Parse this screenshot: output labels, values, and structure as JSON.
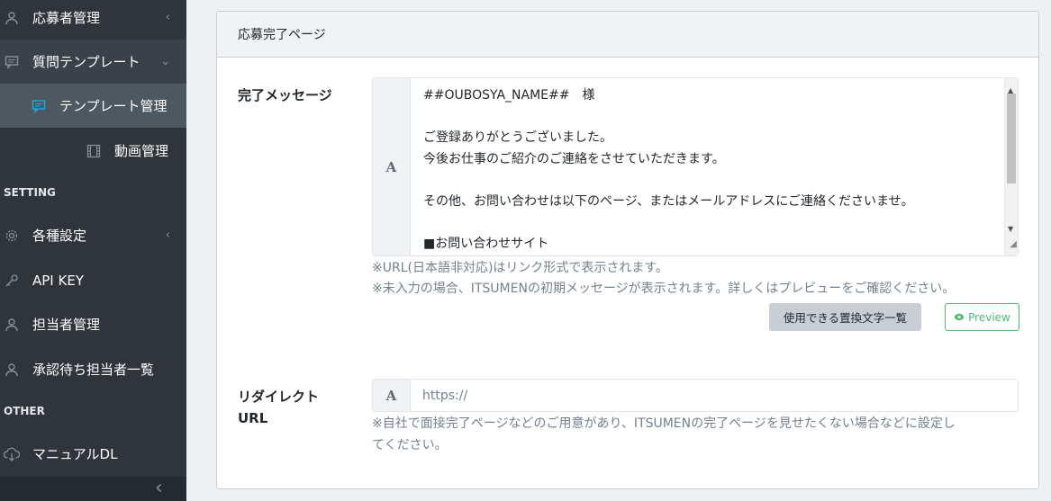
{
  "sidebar": {
    "items": [
      {
        "label": "応募者管理",
        "icon": "user-icon",
        "chevron": "‹"
      },
      {
        "label": "質問テンプレート",
        "icon": "comment-icon",
        "chevron": "⌄"
      },
      {
        "label": "テンプレート管理",
        "icon": "comment-icon"
      },
      {
        "label": "動画管理",
        "icon": "film-icon"
      },
      {
        "label": "各種設定",
        "icon": "gear-icon",
        "chevron": "‹"
      },
      {
        "label": "API KEY",
        "icon": "key-icon"
      },
      {
        "label": "担当者管理",
        "icon": "user-icon"
      },
      {
        "label": "承認待ち担当者一覧",
        "icon": "user-icon"
      },
      {
        "label": "マニュアルDL",
        "icon": "cloud-download-icon"
      }
    ],
    "section_setting": "SETTING",
    "section_other": "OTHER",
    "toggle": "‹"
  },
  "card": {
    "title": "応募完了ページ",
    "complete_message": {
      "label": "完了メッセージ",
      "addon": "A",
      "lines": [
        "##OUBOSYA_NAME##　様",
        "",
        "ご登録ありがとうございました。",
        "今後お仕事のご紹介のご連絡をさせていただきます。",
        "",
        "その他、お問い合わせは以下のページ、またはメールアドレスにご連絡くださいませ。",
        "",
        "■お問い合わせサイト"
      ],
      "help1": "※URL(日本語非対応)はリンク形式で表示されます。",
      "help2": "※未入力の場合、ITSUMENの初期メッセージが表示されます。詳しくはプレビューをご確認ください。",
      "replace_button": "使用できる置換文字一覧",
      "preview_button": "Preview"
    },
    "redirect": {
      "label_line1": "リダイレクト",
      "label_line2": "URL",
      "addon": "A",
      "placeholder": "https://",
      "help_line1": "※自社で面接完了ページなどのご用意があり、ITSUMENの完了ページを見せたくない場合などに設定し",
      "help_line2": "てください。"
    }
  },
  "colors": {
    "sidebar_bg": "#2f353b",
    "accent": "#20a8d8",
    "success": "#4dbd74"
  }
}
